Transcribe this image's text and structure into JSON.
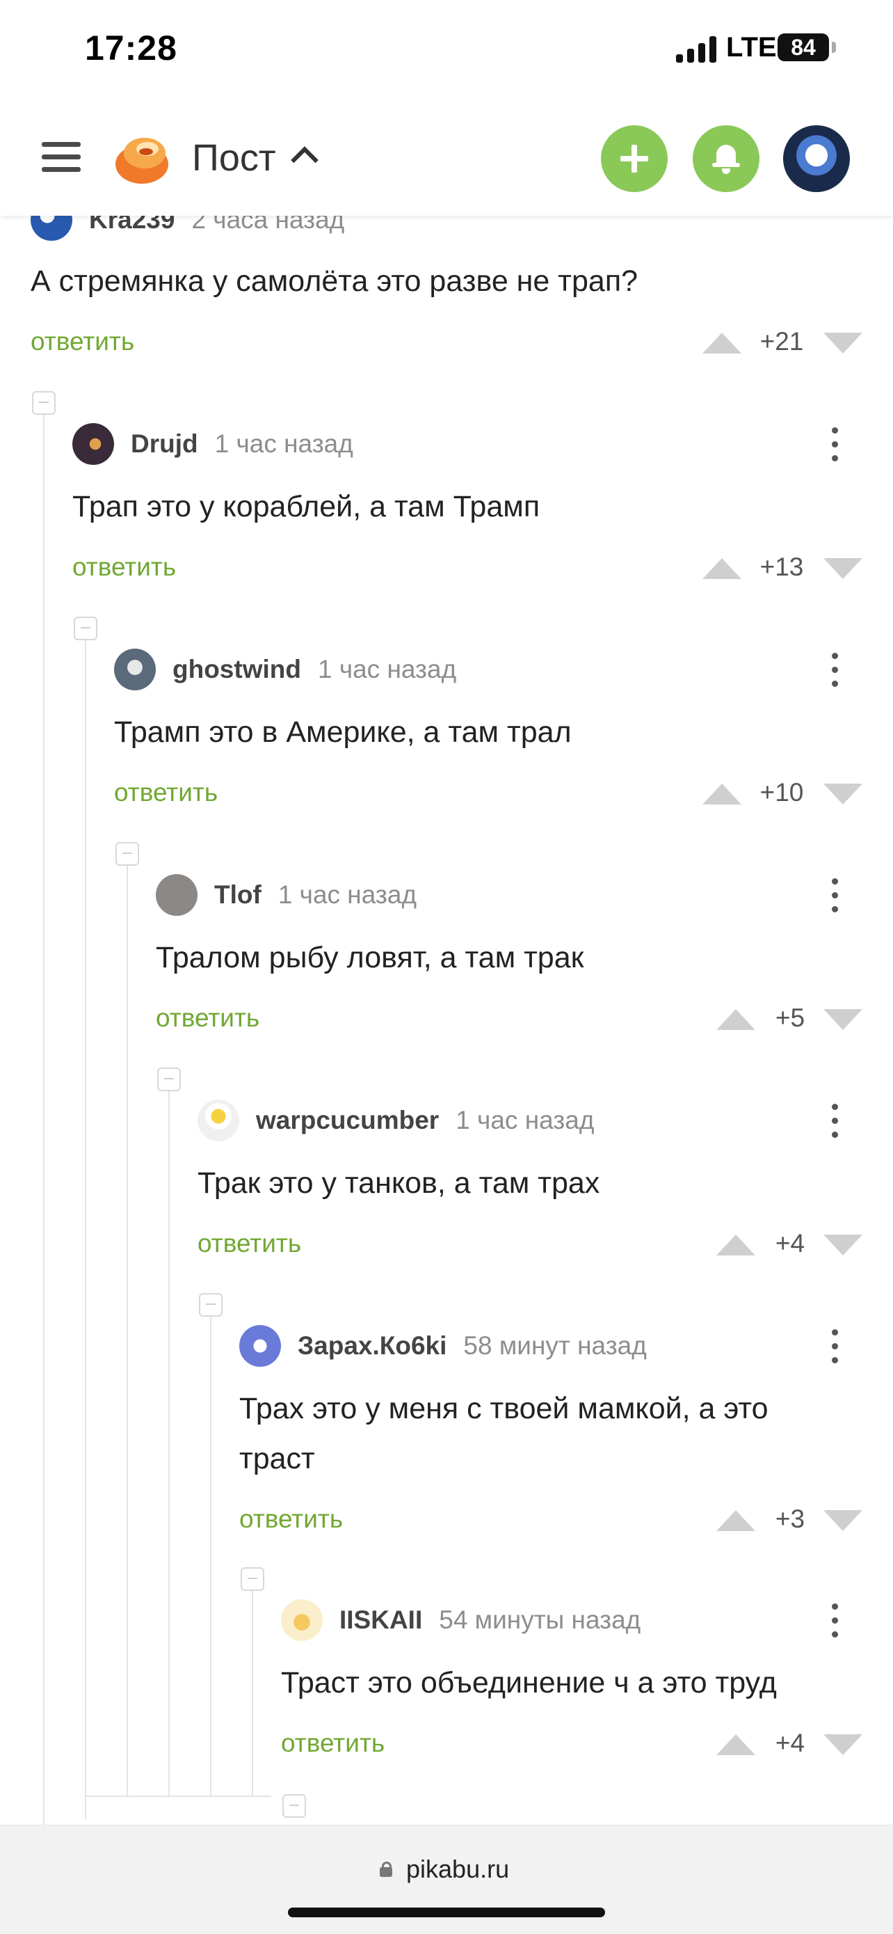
{
  "status_bar": {
    "time": "17:28",
    "network": "LTE",
    "battery": "84"
  },
  "header": {
    "title": "Пост",
    "add_label": "+",
    "notifications": "bell",
    "site_logo": "pikabu-logo"
  },
  "top_comment": {
    "author": "Kra239",
    "time": "2 часа назад",
    "text": "А стремянка у самолёта это разве не трап?",
    "rating": "+21",
    "reply": "ответить"
  },
  "comments": [
    {
      "author": "Drujd",
      "time": "1 час назад",
      "text": "Трап это у кораблей, а там Трамп",
      "rating": "+13",
      "reply": "ответить"
    },
    {
      "author": "ghostwind",
      "time": "1 час назад",
      "text": "Трамп это в Америке, а там трал",
      "rating": "+10",
      "reply": "ответить"
    },
    {
      "author": "Tlof",
      "time": "1 час назад",
      "text": "Тралом рыбу ловят, а там трак",
      "rating": "+5",
      "reply": "ответить"
    },
    {
      "author": "warpcucumber",
      "time": "1 час назад",
      "text": "Трак это у танков, а там трах",
      "rating": "+4",
      "reply": "ответить"
    },
    {
      "author": "Зарах.Ко6ki",
      "time": "58 минут назад",
      "text_line1": "Трах это у меня с твоей мамкой, а это",
      "text_line2": "траст",
      "rating": "+3",
      "reply": "ответить"
    },
    {
      "author": "IISKAII",
      "time": "54 минуты назад",
      "text": "Траст это объединение ч а это труд",
      "rating": "+4",
      "reply": "ответить"
    }
  ],
  "browser": {
    "url": "pikabu.ru"
  },
  "colors": {
    "accent_green": "#8ac858",
    "reply_green": "#70a832"
  }
}
